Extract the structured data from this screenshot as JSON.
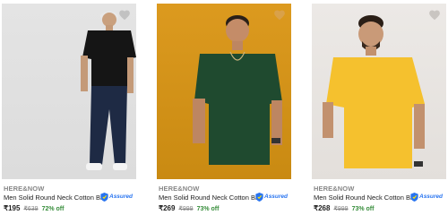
{
  "products": [
    {
      "brand": "HERE&NOW",
      "title": "Men Solid Round Neck Cotton Bl...",
      "assured": "Assured",
      "price": "₹195",
      "mrp": "₹639",
      "discount": "72% off",
      "tshirt_color": "#151515",
      "wishlist_icon": "heart-icon"
    },
    {
      "brand": "HERE&NOW",
      "title": "Men Solid Round Neck Cotton Bl...",
      "assured": "Assured",
      "price": "₹269",
      "mrp": "₹999",
      "discount": "73% off",
      "tshirt_color": "#1f4a2f",
      "wishlist_icon": "heart-icon"
    },
    {
      "brand": "HERE&NOW",
      "title": "Men Solid Round Neck Cotton Bl...",
      "assured": "Assured",
      "price": "₹268",
      "mrp": "₹999",
      "discount": "73% off",
      "tshirt_color": "#f5c12e",
      "wishlist_icon": "heart-icon"
    }
  ],
  "colors": {
    "assured_blue": "#2874f0",
    "discount_green": "#388e3c",
    "muted_text": "#878787"
  }
}
